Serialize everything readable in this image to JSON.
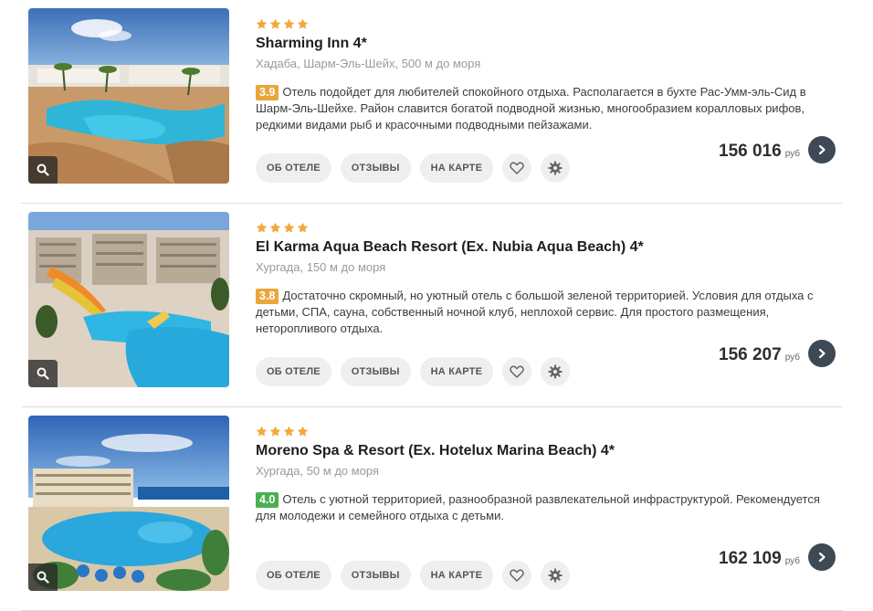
{
  "colors": {
    "star": "#f2a93b",
    "rating_orange": "#e9a63c",
    "rating_green": "#4caf50",
    "go_button": "#3d4954",
    "divider": "#dedede"
  },
  "buttons": {
    "about": "ОБ ОТЕЛЕ",
    "reviews": "ОТЗЫВЫ",
    "map": "НА КАРТЕ"
  },
  "icons": {
    "zoom": "magnifier-icon",
    "favorite": "heart-icon",
    "settings": "gear-icon",
    "go": "chevron-right-icon",
    "star": "star-icon"
  },
  "hotels": [
    {
      "stars": 4,
      "name": "Sharming Inn 4*",
      "location": "Хадаба, Шарм-Эль-Шейх, 500 м до моря",
      "rating": "3.9",
      "rating_color": "#e9a63c",
      "description": "Отель подойдет для любителей спокойного отдыха. Располагается в бухте Рас-Умм-эль-Сид в Шарм-Эль-Шейхе. Район славится богатой подводной жизнью, многообразием коралловых рифов, редкими видами рыб и красочными подводными пейзажами.",
      "price": "156 016",
      "currency": "руб"
    },
    {
      "stars": 4,
      "name": "El Karma Aqua Beach Resort (Ex. Nubia Aqua Beach) 4*",
      "location": "Хургада, 150 м до моря",
      "rating": "3.8",
      "rating_color": "#e9a63c",
      "description": "Достаточно скромный, но уютный отель с большой зеленой территорией. Условия для отдыха с детьми, СПА, сауна, собственный ночной клуб, неплохой сервис. Для простого размещения, неторопливого отдыха.",
      "price": "156 207",
      "currency": "руб"
    },
    {
      "stars": 4,
      "name": "Moreno Spa & Resort (Ex. Hotelux Marina Beach) 4*",
      "location": "Хургада, 50 м до моря",
      "rating": "4.0",
      "rating_color": "#4caf50",
      "description": "Отель с уютной территорией, разнообразной развлекательной инфраструктурой. Рекомендуется для молодежи и семейного отдыха с детьми.",
      "price": "162 109",
      "currency": "руб"
    }
  ]
}
